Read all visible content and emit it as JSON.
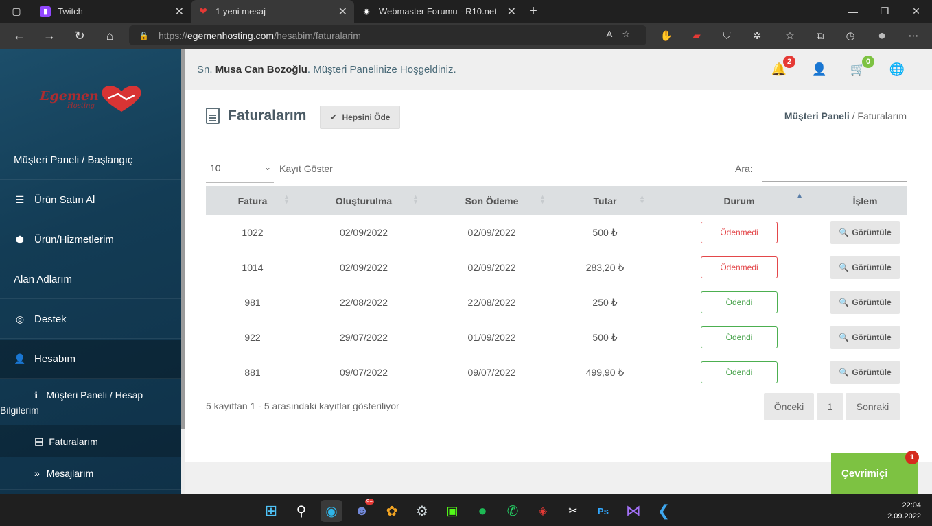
{
  "browser": {
    "tabs": [
      {
        "title": "Twitch",
        "icon": "twitch-icon",
        "color": "#9147ff"
      },
      {
        "title": "1 yeni mesaj",
        "icon": "heart-icon",
        "color": "#e53935"
      },
      {
        "title": "Webmaster Forumu - R10.net",
        "icon": "r10-icon",
        "color": "#ffffff"
      }
    ],
    "url_prefix": "https://",
    "url_host": "egemenhosting.com",
    "url_path": "/hesabim/faturalarim"
  },
  "sidebar": {
    "logo_text": "Egemen",
    "logo_sub": "Hosting",
    "items": [
      {
        "label": "Müşteri Paneli / Başlangıç",
        "icon": ""
      },
      {
        "label": "Ürün Satın Al",
        "icon": "server-icon"
      },
      {
        "label": "Ürün/Hizmetlerim",
        "icon": "cube-icon"
      },
      {
        "label": "Alan Adlarım",
        "icon": ""
      },
      {
        "label": "Destek",
        "icon": "support-icon"
      },
      {
        "label": "Hesabım",
        "icon": "user-icon"
      }
    ],
    "subitems": [
      {
        "label": "Müşteri Paneli / Hesap",
        "label2": "Bilgilerim",
        "icon": "info-icon"
      },
      {
        "label": "Faturalarım",
        "icon": "document-icon"
      },
      {
        "label": "Mesajlarım",
        "icon": "double-chevron-icon"
      }
    ]
  },
  "topbar": {
    "greeting_prefix": "Sn. ",
    "user_name": "Musa Can Bozoğlu",
    "greeting_suffix": ". Müşteri Panelinize Hoşgeldiniz.",
    "notif_count": "2",
    "cart_count": "0"
  },
  "page": {
    "title": "Faturalarım",
    "pay_all": "Hepsini Öde",
    "crumb_root": "Müşteri Paneli",
    "crumb_sep": " / ",
    "crumb_current": "Faturalarım"
  },
  "table": {
    "length_value": "10",
    "length_label": "Kayıt Göster",
    "search_label": "Ara:",
    "columns": [
      "Fatura",
      "Oluşturulma",
      "Son Ödeme",
      "Tutar",
      "Durum",
      "İşlem"
    ],
    "rows": [
      {
        "id": "1022",
        "created": "02/09/2022",
        "due": "02/09/2022",
        "amount": "500 ₺",
        "status": "Ödenmedi",
        "paid": false
      },
      {
        "id": "1014",
        "created": "02/09/2022",
        "due": "02/09/2022",
        "amount": "283,20 ₺",
        "status": "Ödenmedi",
        "paid": false
      },
      {
        "id": "981",
        "created": "22/08/2022",
        "due": "22/08/2022",
        "amount": "250 ₺",
        "status": "Ödendi",
        "paid": true
      },
      {
        "id": "922",
        "created": "29/07/2022",
        "due": "01/09/2022",
        "amount": "500 ₺",
        "status": "Ödendi",
        "paid": true
      },
      {
        "id": "881",
        "created": "09/07/2022",
        "due": "09/07/2022",
        "amount": "499,90 ₺",
        "status": "Ödendi",
        "paid": true
      }
    ],
    "view_label": "Görüntüle",
    "info": "5 kayıttan 1 - 5 arasındaki kayıtlar gösteriliyor",
    "prev": "Önceki",
    "page": "1",
    "next": "Sonraki"
  },
  "online": {
    "label": "Çevrimiçi",
    "count": "1"
  },
  "taskbar": {
    "discord_badge": "9+",
    "time": "22:04",
    "date": "2.09.2022"
  },
  "colors": {
    "accent": "#7dc242",
    "unpaid": "#e3474a",
    "paid": "#43a047",
    "sidebar": "#133c55"
  }
}
